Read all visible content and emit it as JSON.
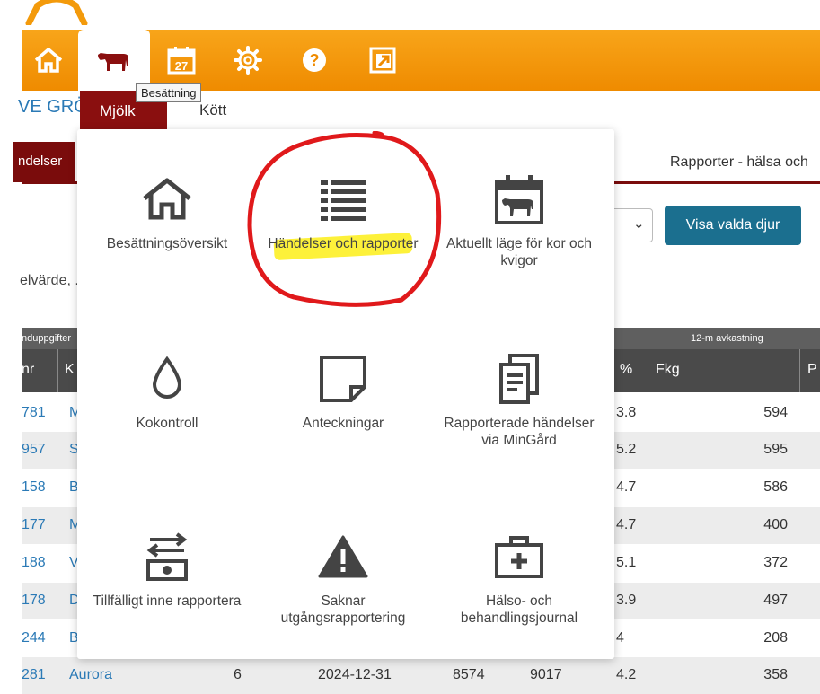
{
  "colors": {
    "orange_bar": "#f39a0b",
    "maroon": "#8a0f0f",
    "link_blue": "#2b7ab6",
    "teal_button": "#1b6f8f",
    "highlight_yellow": "#fdf13a",
    "annotation_red": "#e0191b"
  },
  "nav": {
    "icons": [
      "home-icon",
      "cow-icon",
      "calendar-icon",
      "gear-icon",
      "help-icon",
      "external-link-icon"
    ],
    "calendar_day": "27",
    "tooltip": "Besättning"
  },
  "subnav": {
    "org_fragment": "VE GRÖ",
    "tab_mjolk": "Mjölk",
    "tab_kott": "Kött"
  },
  "page": {
    "left_tab": "ndelser",
    "right_tab": "Rapporter - hälsa och",
    "show_button": "Visa valda djur",
    "search_fragment": "elvärde, ..."
  },
  "table": {
    "group_left": "nduppgifter",
    "group_right": "12-m avkastning",
    "col_nr": "nr",
    "col_k": "K",
    "col_pct": "%",
    "col_fkg": "Fkg",
    "col_p": "P",
    "rows": [
      {
        "nr": "781",
        "name": "M",
        "pct": "3.8",
        "fkg": "594"
      },
      {
        "nr": "957",
        "name": "S",
        "pct": "5.2",
        "fkg": "595"
      },
      {
        "nr": "158",
        "name": "B",
        "pct": "4.7",
        "fkg": "586"
      },
      {
        "nr": "177",
        "name": "M",
        "pct": "4.7",
        "fkg": "400"
      },
      {
        "nr": "188",
        "name": "V",
        "pct": "5.1",
        "fkg": "372"
      },
      {
        "nr": "178",
        "name": "D",
        "pct": "3.9",
        "fkg": "497"
      },
      {
        "nr": "244",
        "name": "B",
        "pct": "4",
        "fkg": "208"
      },
      {
        "nr": "281",
        "name": "Aurora",
        "c3": "6",
        "c4": "2024-12-31",
        "c5": "8574",
        "c6": "9017",
        "pct": "4.2",
        "fkg": "358"
      }
    ]
  },
  "menu": {
    "items": [
      {
        "label": "Besättningsöversikt",
        "icon": "home-outline-icon"
      },
      {
        "label": "Händelser och rapporter",
        "icon": "list-icon"
      },
      {
        "label": "Aktuellt läge för kor och kvigor",
        "icon": "calendar-cow-icon"
      },
      {
        "label": "Kokontroll",
        "icon": "drop-icon"
      },
      {
        "label": "Anteckningar",
        "icon": "note-icon"
      },
      {
        "label": "Rapporterade händelser via MinGård",
        "icon": "documents-icon"
      },
      {
        "label": "Tillfälligt inne rapportera",
        "icon": "transfer-icon"
      },
      {
        "label": "Saknar utgångsrapportering",
        "icon": "warning-icon"
      },
      {
        "label": "Hälso- och behandlingsjournal",
        "icon": "medical-kit-icon"
      }
    ]
  }
}
